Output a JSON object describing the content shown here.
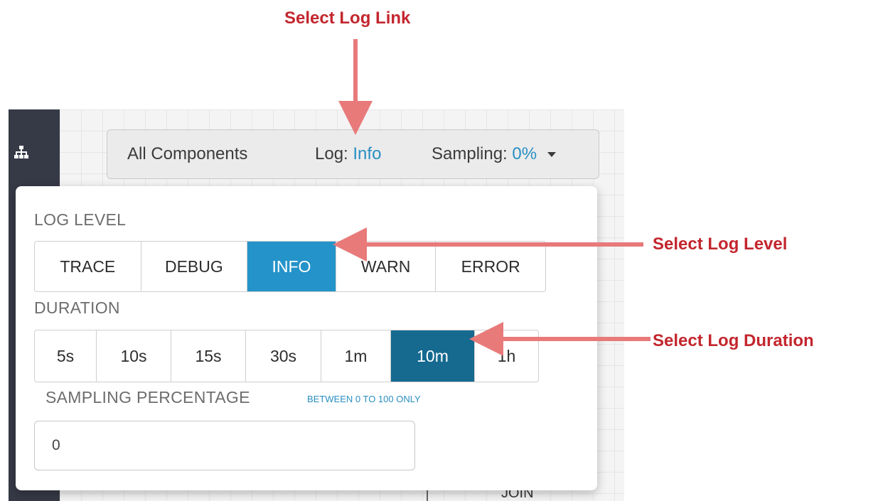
{
  "annotations": {
    "log_link": "Select Log Link",
    "log_level": "Select Log Level",
    "log_duration": "Select Log Duration",
    "color": "#c3262e"
  },
  "toolbar": {
    "components": "All Components",
    "log_prefix": "Log:",
    "log_value": "Info",
    "sampling_prefix": "Sampling:",
    "sampling_value": "0%"
  },
  "log_panel": {
    "log_level_label": "LOG LEVEL",
    "levels": [
      "TRACE",
      "DEBUG",
      "INFO",
      "WARN",
      "ERROR"
    ],
    "selected_level": "INFO",
    "duration_label": "DURATION",
    "durations": [
      "5s",
      "10s",
      "15s",
      "30s",
      "1m",
      "10m",
      "1h"
    ],
    "selected_duration": "10m",
    "sampling_label": "SAMPLING PERCENTAGE",
    "sampling_hint": "BETWEEN 0 TO 100 ONLY",
    "sampling_value": "0"
  },
  "canvas": {
    "node_label": "JOIN"
  },
  "colors": {
    "link": "#2a8fc3",
    "active_level": "#2493c9",
    "active_duration": "#16698f",
    "sidebar": "#363946"
  },
  "icons": {
    "sidebar_top": "topology-icon",
    "toolbar_caret": "chevron-down-icon"
  }
}
